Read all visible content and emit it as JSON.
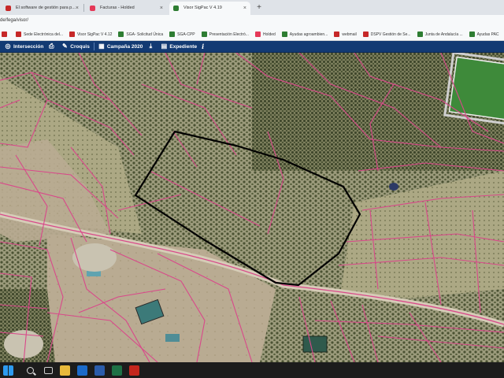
{
  "browser": {
    "tabs": [
      {
        "title": "El software de gestión para p...",
        "favicon_color": "#c62828",
        "active": false
      },
      {
        "title": "Facturas - Holded",
        "favicon_color": "#e53958",
        "active": false
      },
      {
        "title": "Visor SigPac V 4.19",
        "favicon_color": "#2e7d32",
        "active": true
      }
    ],
    "close_glyph": "×",
    "new_tab_glyph": "+",
    "url": "de/fega/visor/",
    "bookmarks": [
      {
        "label": "",
        "icon_color": "#c62828"
      },
      {
        "label": "Sede Electrónica del...",
        "icon_color": "#c62828"
      },
      {
        "label": "Visor SigPac V 4.12",
        "icon_color": "#c62828"
      },
      {
        "label": "SGA- Solicitud Única",
        "icon_color": "#2e7d32"
      },
      {
        "label": "SGA-CPP",
        "icon_color": "#2e7d32"
      },
      {
        "label": "Presentación Electró...",
        "icon_color": "#2e7d32"
      },
      {
        "label": "Holded",
        "icon_color": "#e53958"
      },
      {
        "label": "Ayudas agroambien...",
        "icon_color": "#2e7d32"
      },
      {
        "label": "webmail",
        "icon_color": "#c62828"
      },
      {
        "label": "DSPV Gestión de Se...",
        "icon_color": "#c62828"
      },
      {
        "label": "Junta de Andalucía ...",
        "icon_color": "#2e7d32"
      },
      {
        "label": "Ayudas PAC",
        "icon_color": "#2e7d32"
      }
    ]
  },
  "toolbar": {
    "intersection_label": "Intersección",
    "croquis_label": "Croquis",
    "campaign_label": "Campaña 2020",
    "expediente_label": "Expediente",
    "info_glyph": "i"
  },
  "colors": {
    "toolbar_bg": "#123a73",
    "parcel_line": "#d9488a",
    "selection_line": "#000000"
  }
}
